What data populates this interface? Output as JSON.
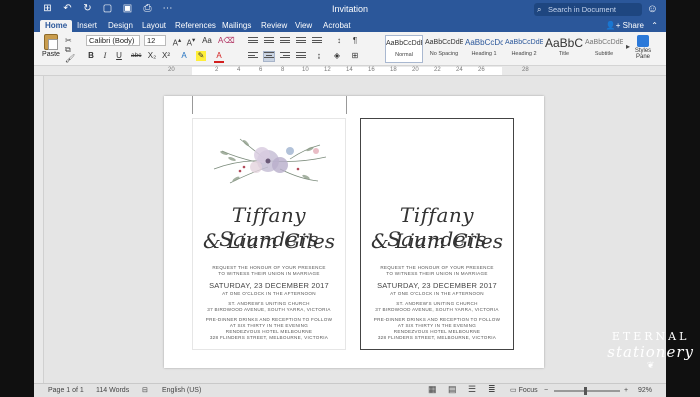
{
  "app": {
    "title": "Invitation",
    "search_placeholder": "Search in Document",
    "accent": "#2b579a"
  },
  "tabs": [
    "Home",
    "Insert",
    "Design",
    "Layout",
    "References",
    "Mailings",
    "Review",
    "View",
    "Acrobat"
  ],
  "share_label": "Share",
  "ribbon": {
    "paste_label": "Paste",
    "font_name": "Calibri (Body)",
    "font_size": "12",
    "styles": [
      {
        "sample": "AaBbCcDdEe",
        "name": "Normal"
      },
      {
        "sample": "AaBbCcDdEe",
        "name": "No Spacing"
      },
      {
        "sample": "AaBbCcDc",
        "name": "Heading 1"
      },
      {
        "sample": "AaBbCcDdEe",
        "name": "Heading 2"
      },
      {
        "sample": "AaBbC",
        "name": "Title"
      },
      {
        "sample": "AaBbCcDdEe",
        "name": "Subtitle"
      }
    ],
    "styles_pane_label": "Styles Pane"
  },
  "ruler": {
    "numbers": [
      "20",
      "2",
      "4",
      "6",
      "8",
      "10",
      "12",
      "14",
      "16",
      "18",
      "20",
      "22",
      "24",
      "26",
      "28"
    ]
  },
  "invitation": {
    "name1": "Tiffany Saunders",
    "name2": "& Liam Giles",
    "request_line1": "Request the honour of your presence",
    "request_line2": "to witness their union in marriage",
    "date": "SATURDAY, 23 DECEMBER 2017",
    "time": "At one o'clock in the afternoon",
    "venue1": "St. Andrew's Uniting Church",
    "venue2": "37 Birdwood Avenue, South Yarra, Victoria",
    "dinner1": "Pre-dinner drinks and reception to follow",
    "dinner2": "At six thirty in the evening",
    "dinner3": "Rendezvous Hotel Melbourne",
    "dinner4": "328 Flinders Street, Melbourne, Victoria"
  },
  "brand": {
    "line1": "ETERNAL",
    "line2": "stationery"
  },
  "status": {
    "page": "Page 1 of 1",
    "words": "114 Words",
    "language": "English (US)",
    "focus": "Focus",
    "zoom": "92%"
  }
}
